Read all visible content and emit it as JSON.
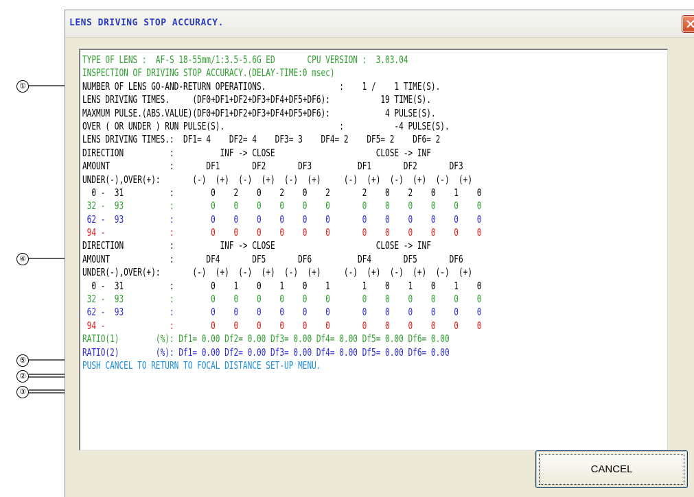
{
  "window": {
    "title": "LENS DRIVING STOP ACCURACY."
  },
  "callouts": [
    "①",
    "④",
    "⑤",
    "②",
    "③"
  ],
  "colors": {
    "green": "#2e9e2e",
    "blue": "#2a2ad8",
    "red": "#e02020",
    "cyan": "#1f8ed8",
    "black": "#000000"
  },
  "report": [
    {
      "text": "TYPE OF LENS :  AF-S 18-55mm/1:3.5-5.6G ED       CPU VERSION :  3.03.04",
      "color": "green"
    },
    {
      "text": "INSPECTION OF DRIVING STOP ACCURACY.(DELAY-TIME:0 msec)",
      "color": "green"
    },
    {
      "text": "NUMBER OF LENS GO-AND-RETURN OPERATIONS.                :    1 /    1 TIME(S).",
      "color": "black"
    },
    {
      "text": "LENS DRIVING TIMES.     (DF0+DF1+DF2+DF3+DF4+DF5+DF6):           19 TIME(S).",
      "color": "black"
    },
    {
      "text": "MAXMUM PULSE.(ABS.VALUE)(DF0+DF1+DF2+DF3+DF4+DF5+DF6):            4 PULSE(S).",
      "color": "black"
    },
    {
      "text": "OVER ( OR UNDER ) RUN PULSE(S).                         :           -4 PULSE(S).",
      "color": "black"
    },
    {
      "text": "LENS DRIVING TIMES.:  DF1= 4    DF2= 4    DF3= 3    DF4= 2    DF5= 2    DF6= 2",
      "color": "black"
    },
    {
      "text": "DIRECTION          :          INF -> CLOSE                      CLOSE -> INF",
      "color": "black"
    },
    {
      "text": "AMOUNT             :       DF1       DF2       DF3          DF1       DF2       DF3",
      "color": "black"
    },
    {
      "text": "UNDER(-),OVER(+):       (-)  (+)  (-)  (+)  (-)  (+)     (-)  (+)  (-)  (+)  (-)  (+)",
      "color": "black"
    },
    {
      "text": "  0 -  31          :        0    2    0    2    0    2       2    0    2    0    1    0",
      "color": "black"
    },
    {
      "text": " 32 -  93          :        0    0    0    0    0    0       0    0    0    0    0    0",
      "color": "green"
    },
    {
      "text": " 62 -  93          :        0    0    0    0    0    0       0    0    0    0    0    0",
      "color": "blue"
    },
    {
      "text": " 94 -              :        0    0    0    0    0    0       0    0    0    0    0    0",
      "color": "red"
    },
    {
      "text": "DIRECTION          :          INF -> CLOSE                      CLOSE -> INF",
      "color": "black"
    },
    {
      "text": "AMOUNT             :       DF4       DF5       DF6          DF4       DF5       DF6",
      "color": "black"
    },
    {
      "text": "UNDER(-),OVER(+):       (-)  (+)  (-)  (+)  (-)  (+)     (-)  (+)  (-)  (+)  (-)  (+)",
      "color": "black"
    },
    {
      "text": "  0 -  31          :        0    1    0    1    0    1       1    0    1    0    1    0",
      "color": "black"
    },
    {
      "text": " 32 -  93          :        0    0    0    0    0    0       0    0    0    0    0    0",
      "color": "green"
    },
    {
      "text": " 62 -  93          :        0    0    0    0    0    0       0    0    0    0    0    0",
      "color": "blue"
    },
    {
      "text": " 94 -              :        0    0    0    0    0    0       0    0    0    0    0    0",
      "color": "red"
    },
    {
      "text": "RATIO(1)        (%): Df1= 0.00 Df2= 0.00 Df3= 0.00 Df4= 0.00 Df5= 0.00 Df6= 0.00",
      "color": "green"
    },
    {
      "text": "RATIO(2)        (%): Df1= 0.00 Df2= 0.00 Df3= 0.00 Df4= 0.00 Df5= 0.00 Df6= 0.00",
      "color": "blue"
    },
    {
      "text": "PUSH CANCEL TO RETURN TO FOCAL DISTANCE SET-UP MENU.",
      "color": "cyan"
    }
  ],
  "buttons": {
    "cancel_label": "CANCEL"
  }
}
